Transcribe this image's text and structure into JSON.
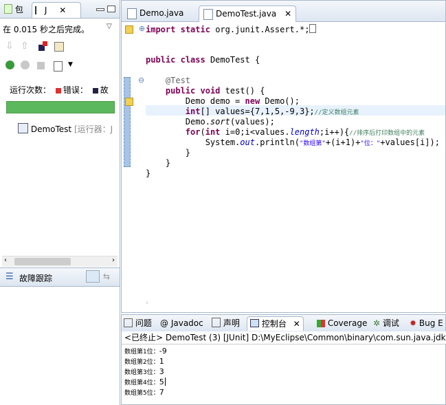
{
  "left_panel": {
    "tabs": [
      {
        "label": "包"
      },
      {
        "label": "J"
      }
    ],
    "status_text": "在 0.015 秒之后完成。",
    "runs_label": "运行次数：",
    "errors_label": "错误：",
    "failures_label": "故",
    "progress_fraction": 1.0,
    "progress_color": "#5cb85c",
    "tree_item": {
      "label": "DemoTest",
      "suffix": "[运行器：J"
    },
    "failure_trace_label": "故障跟踪"
  },
  "editor": {
    "tabs": [
      {
        "label": "Demo.java"
      },
      {
        "label": "DemoTest.java"
      }
    ],
    "code": {
      "import_kw": "import",
      "static_kw": "static",
      "import_rest": "org.junit.Assert.*;",
      "public_kw": "public",
      "class_kw": "class",
      "class_name": "DemoTest {",
      "annotation": "@Test",
      "void_kw": "void",
      "method": "test() {",
      "line_demo_a": "Demo demo = ",
      "new_kw": "new",
      "line_demo_b": " Demo();",
      "int_kw": "int",
      "line_values": "[] values={7,1,5,-9,3};",
      "comment1": "//定义数组元素",
      "sort_a": "Demo.",
      "sort_b": "sort",
      "sort_c": "(values);",
      "for_kw": "for",
      "for_a": "(",
      "for_b": " i=0;i<values.",
      "length": "length",
      "for_c": ";i++){",
      "comment2": "//排序后打印数组中的元素",
      "print_a": "System.",
      "out": "out",
      "print_b": ".println(",
      "str1": "\"数组第\"",
      "print_c": "+(i+1)+",
      "str2": "\"位：\"",
      "print_d": "+values[i]);",
      "close1": "}",
      "close2": "}",
      "close3": "}"
    }
  },
  "console": {
    "tabs": [
      {
        "label": "问题"
      },
      {
        "label": "Javadoc"
      },
      {
        "label": "声明"
      },
      {
        "label": "控制台"
      },
      {
        "label": "Coverage"
      },
      {
        "label": "调试"
      },
      {
        "label": "Bug E"
      }
    ],
    "header": "<已终止> DemoTest (3) [JUnit] D:\\MyEclipse\\Common\\binary\\com.sun.java.jdk.",
    "output": [
      {
        "label": "数组第1位：",
        "value": "-9"
      },
      {
        "label": "数组第2位：",
        "value": "1"
      },
      {
        "label": "数组第3位：",
        "value": "3"
      },
      {
        "label": "数组第4位：",
        "value": "5"
      },
      {
        "label": "数组第5位：",
        "value": "7"
      }
    ]
  }
}
